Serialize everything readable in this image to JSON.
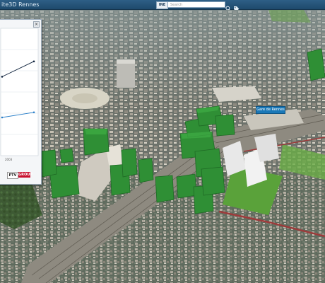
{
  "header": {
    "title": "ite3D Rennes",
    "scope_button": "INE",
    "search": {
      "placeholder": "Search",
      "value": ""
    },
    "icons": [
      "search-icon",
      "tag-icon"
    ]
  },
  "map": {
    "landmark_label": "Gare de Rennes"
  },
  "chart_panel": {
    "close_label": "×",
    "x_tick_label": "2003",
    "logos": {
      "ptv": "PTV",
      "group": "GROUP"
    }
  },
  "chart_data": {
    "type": "line",
    "title": "",
    "xlabel": "",
    "ylabel": "",
    "grid": true,
    "series": [
      {
        "values": [
          0.62,
          0.74
        ],
        "color": "#0b1f3a"
      },
      {
        "values": [
          0.3,
          0.34
        ],
        "color": "#2a7fc9"
      }
    ]
  },
  "colors": {
    "header_bar": "#2b5b82",
    "building_green": "#3a9d3a",
    "rail_area": "#8b4a4a"
  }
}
